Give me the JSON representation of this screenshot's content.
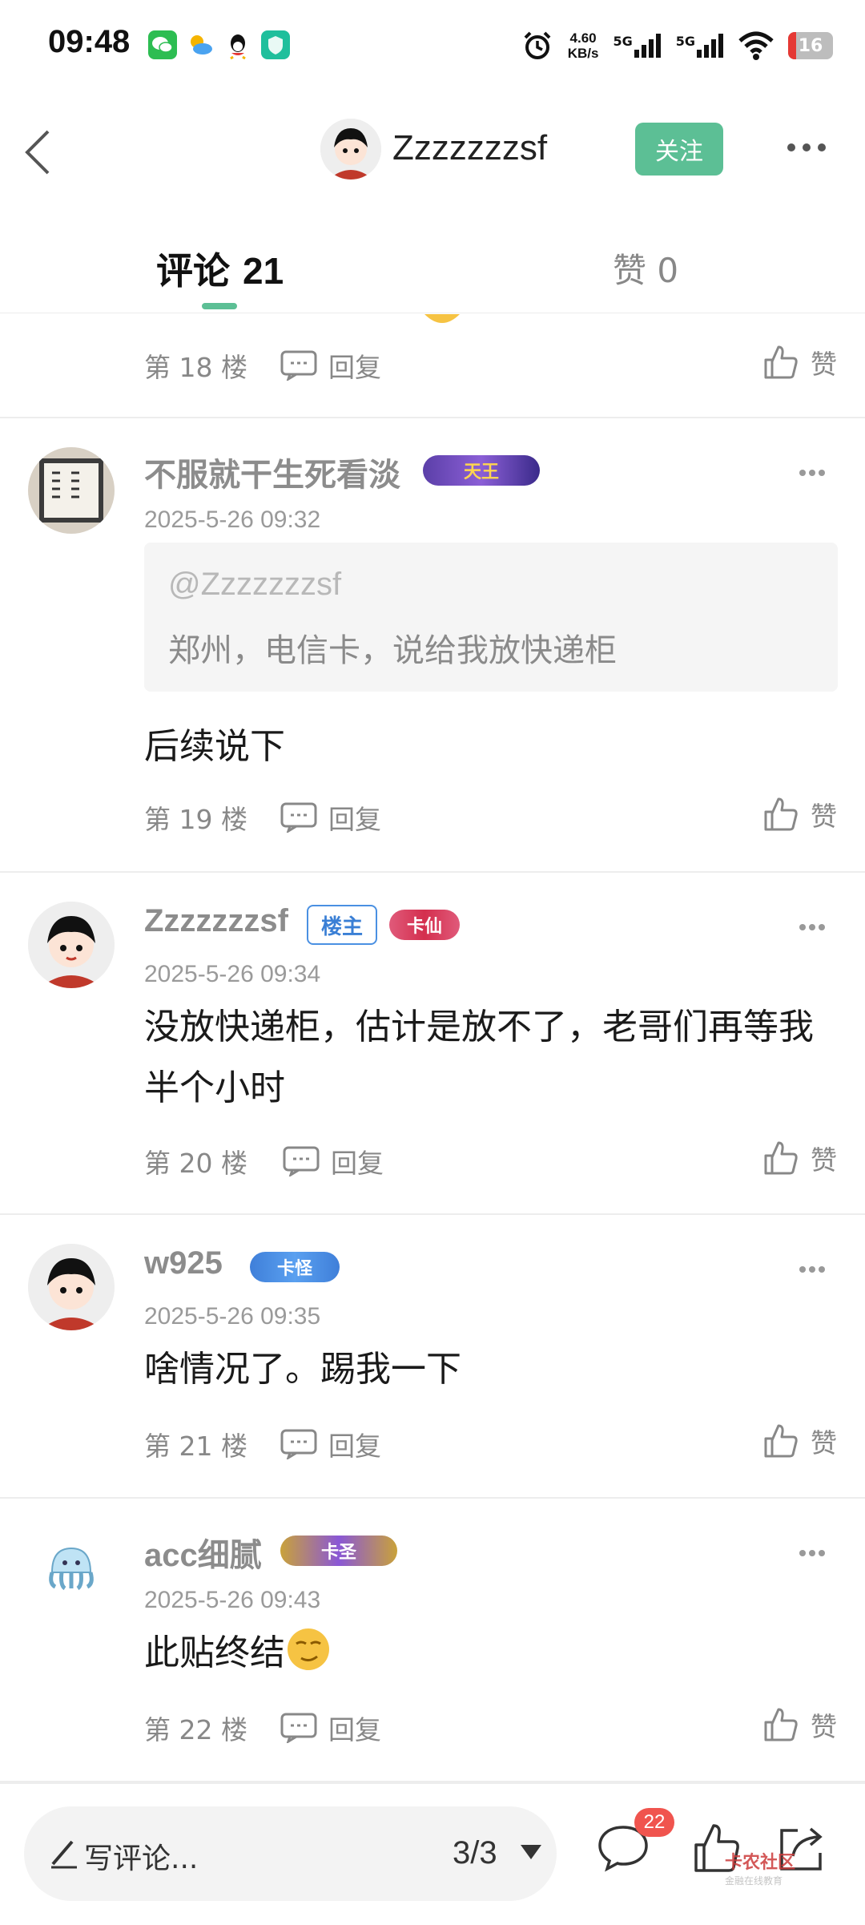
{
  "status_bar": {
    "time": "09:48",
    "speed_value": "4.60",
    "speed_unit": "KB/s",
    "net1": "5G",
    "net2": "5G",
    "battery": "16",
    "app_icons": [
      "wechat-icon",
      "weather-icon",
      "qq-icon",
      "shield-app-icon"
    ]
  },
  "header": {
    "username": "Zzzzzzzsf",
    "follow_label": "关注"
  },
  "tabs": {
    "comments_label": "评论",
    "comments_count": "21",
    "likes_label": "赞",
    "likes_count": "0"
  },
  "labels": {
    "reply": "回复",
    "like": "赞"
  },
  "comments": [
    {
      "floor": "第 18 楼"
    },
    {
      "username": "不服就干生死看淡",
      "badge": "天王",
      "date": "2025-5-26 09:32",
      "quote_user": "@Zzzzzzzsf",
      "quote_text": "郑州，电信卡，说给我放快递柜",
      "text": "后续说下",
      "floor": "第 19 楼"
    },
    {
      "username": "Zzzzzzzsf",
      "owner_tag": "楼主",
      "badge": "卡仙",
      "date": "2025-5-26 09:34",
      "text": "没放快递柜，估计是放不了，老哥们再等我半个小时",
      "floor": "第 20 楼"
    },
    {
      "username": "w925",
      "badge": "卡怪",
      "date": "2025-5-26 09:35",
      "text": "啥情况了。踢我一下",
      "floor": "第 21 楼"
    },
    {
      "username": "acc细腻",
      "badge": "卡圣",
      "date": "2025-5-26 09:43",
      "text": "此贴终结",
      "floor": "第 22 楼"
    }
  ],
  "bottom_bar": {
    "write_label": "写评论...",
    "page_indicator": "3/3",
    "comment_count": "22",
    "watermark": "卡农社区",
    "watermark_sub": "金融在线教育"
  },
  "colors": {
    "accent": "#5cbf95",
    "badge_red": "#f0544e",
    "owner_blue": "#4a90e2"
  }
}
